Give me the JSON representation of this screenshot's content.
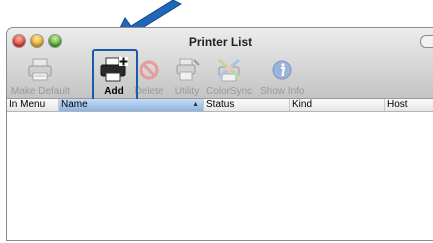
{
  "window": {
    "title": "Printer List"
  },
  "toolbar": {
    "make_default_label": "Make Default",
    "add_label": "Add",
    "delete_label": "Delete",
    "utility_label": "Utility",
    "colorsync_label": "ColorSync",
    "show_info_label": "Show Info"
  },
  "columns": {
    "in_menu": "In Menu",
    "name": "Name",
    "status": "Status",
    "kind": "Kind",
    "host": "Host"
  },
  "colors": {
    "highlight": "#1a5aa6",
    "arrow": "#2266b8"
  },
  "icons": {
    "make_default": "printer-icon",
    "add": "add-printer-icon",
    "delete": "delete-icon",
    "utility": "utility-icon",
    "colorsync": "colorsync-icon",
    "show_info": "info-icon"
  }
}
